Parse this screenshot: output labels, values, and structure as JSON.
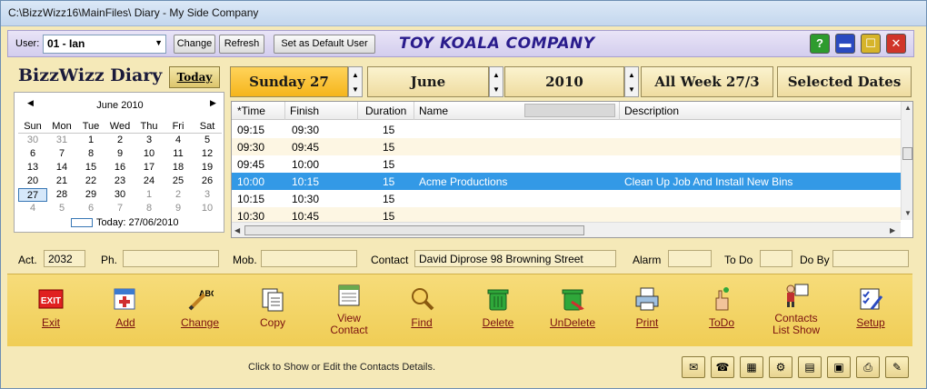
{
  "window": {
    "title": "C:\\BizzWizz16\\MainFiles\\ Diary - My Side Company"
  },
  "toolbar": {
    "user_label": "User:",
    "user_value": "01 - Ian",
    "change_label": "Change",
    "refresh_label": "Refresh",
    "default_user_label": "Set as Default User",
    "company_name": "TOY KOALA COMPANY",
    "help_glyph": "?"
  },
  "leftpanel": {
    "title": "BizzWizz Diary",
    "today_button": "Today"
  },
  "calendar": {
    "month": "June 2010",
    "weekdays": [
      "Sun",
      "Mon",
      "Tue",
      "Wed",
      "Thu",
      "Fri",
      "Sat"
    ],
    "weeks": [
      [
        "30",
        "31",
        "1",
        "2",
        "3",
        "4",
        "5"
      ],
      [
        "6",
        "7",
        "8",
        "9",
        "10",
        "11",
        "12"
      ],
      [
        "13",
        "14",
        "15",
        "16",
        "17",
        "18",
        "19"
      ],
      [
        "20",
        "21",
        "22",
        "23",
        "24",
        "25",
        "26"
      ],
      [
        "27",
        "28",
        "29",
        "30",
        "1",
        "2",
        "3"
      ],
      [
        "4",
        "5",
        "6",
        "7",
        "8",
        "9",
        "10"
      ]
    ],
    "today_text": "Today: 27/06/2010"
  },
  "datebar": {
    "day": "Sunday 27",
    "month": "June",
    "year": "2010",
    "week": "All Week 27/3",
    "selected": "Selected Dates"
  },
  "grid": {
    "columns": {
      "time": "*Time",
      "finish": "Finish",
      "duration": "Duration",
      "name": "Name",
      "description": "Description"
    },
    "rows": [
      {
        "time": "09:15",
        "finish": "09:30",
        "duration": "15",
        "name": "",
        "description": ""
      },
      {
        "time": "09:30",
        "finish": "09:45",
        "duration": "15",
        "name": "",
        "description": ""
      },
      {
        "time": "09:45",
        "finish": "10:00",
        "duration": "15",
        "name": "",
        "description": ""
      },
      {
        "time": "10:00",
        "finish": "10:15",
        "duration": "15",
        "name": "Acme Productions",
        "description": "Clean Up Job And Install New Bins"
      },
      {
        "time": "10:15",
        "finish": "10:30",
        "duration": "15",
        "name": "",
        "description": ""
      },
      {
        "time": "10:30",
        "finish": "10:45",
        "duration": "15",
        "name": "",
        "description": ""
      }
    ]
  },
  "details": {
    "act_label": "Act.",
    "act_value": "2032",
    "ph_label": "Ph.",
    "ph_value": "",
    "mob_label": "Mob.",
    "mob_value": "",
    "contact_label": "Contact",
    "contact_value": "David Diprose 98 Browning Street",
    "alarm_label": "Alarm",
    "alarm_value": "",
    "todo_label": "To Do",
    "todo_value": "",
    "doby_label": "Do By",
    "doby_value": ""
  },
  "actions": {
    "exit": "Exit",
    "add": "Add",
    "change": "Change",
    "copy": "Copy",
    "view_contact_1": "View",
    "view_contact_2": "Contact",
    "find": "Find",
    "delete": "Delete",
    "undelete": "UnDelete",
    "print": "Print",
    "todo": "ToDo",
    "contacts_list_1": "Contacts",
    "contacts_list_2": "List Show",
    "setup": "Setup"
  },
  "status": {
    "text": "Click to Show or Edit the Contacts Details."
  }
}
